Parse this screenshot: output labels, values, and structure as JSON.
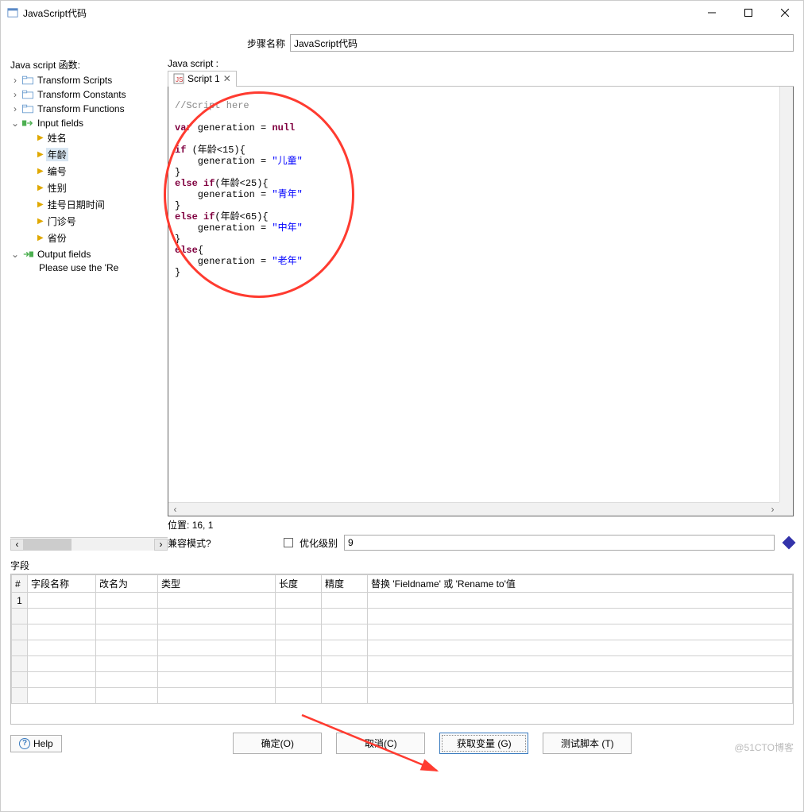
{
  "window": {
    "title": "JavaScript代码"
  },
  "step_name": {
    "label": "步骤名称",
    "value": "JavaScript代码"
  },
  "left_panel": {
    "title": "Java script 函数:",
    "transform_scripts": "Transform Scripts",
    "transform_constants": "Transform Constants",
    "transform_functions": "Transform Functions",
    "input_fields": "Input fields",
    "in_items": {
      "a": "姓名",
      "b": "年龄",
      "c": "编号",
      "d": "性别",
      "e": "挂号日期时间",
      "f": "门诊号",
      "g": "省份"
    },
    "output_fields": "Output fields",
    "output_help": "Please use the 'Re"
  },
  "right_panel": {
    "title": "Java script :",
    "tab": "Script 1"
  },
  "editor": {
    "comment": "//Script here",
    "l2_var": "var",
    "l2_rest": " generation = ",
    "l2_null": "null",
    "l4_if": "if",
    "l4_rest": " (年龄<15){",
    "l5": "    generation = ",
    "l5_str": "\"儿童\"",
    "l6": "}",
    "l7_else": "else if",
    "l7_rest": "(年龄<25){",
    "l8": "    generation = ",
    "l8_str": "\"青年\"",
    "l9": "}",
    "l10_else": "else if",
    "l10_rest": "(年龄<65){",
    "l11": "    generation = ",
    "l11_str": "\"中年\"",
    "l12": "}",
    "l13_else": "else",
    "l13_rest": "{",
    "l14": "    generation = ",
    "l14_str": "\"老年\"",
    "l15": "}"
  },
  "status": {
    "pos_label": "位置:",
    "pos_value": "16, 1"
  },
  "compat": {
    "label": "兼容模式?",
    "opt_label": "优化级别",
    "opt_value": "9"
  },
  "fields": {
    "title": "字段",
    "header_num": "#",
    "headers": {
      "a": "字段名称",
      "b": "改名为",
      "c": "类型",
      "d": "长度",
      "e": "精度",
      "f": "替换 'Fieldname' 或 'Rename to'值"
    },
    "row1": "1"
  },
  "buttons": {
    "help": "Help",
    "ok": "确定(O)",
    "cancel": "取消(C)",
    "getvars": "获取变量 (G)",
    "test": "测试脚本 (T)"
  },
  "watermark": "@51CTO博客"
}
